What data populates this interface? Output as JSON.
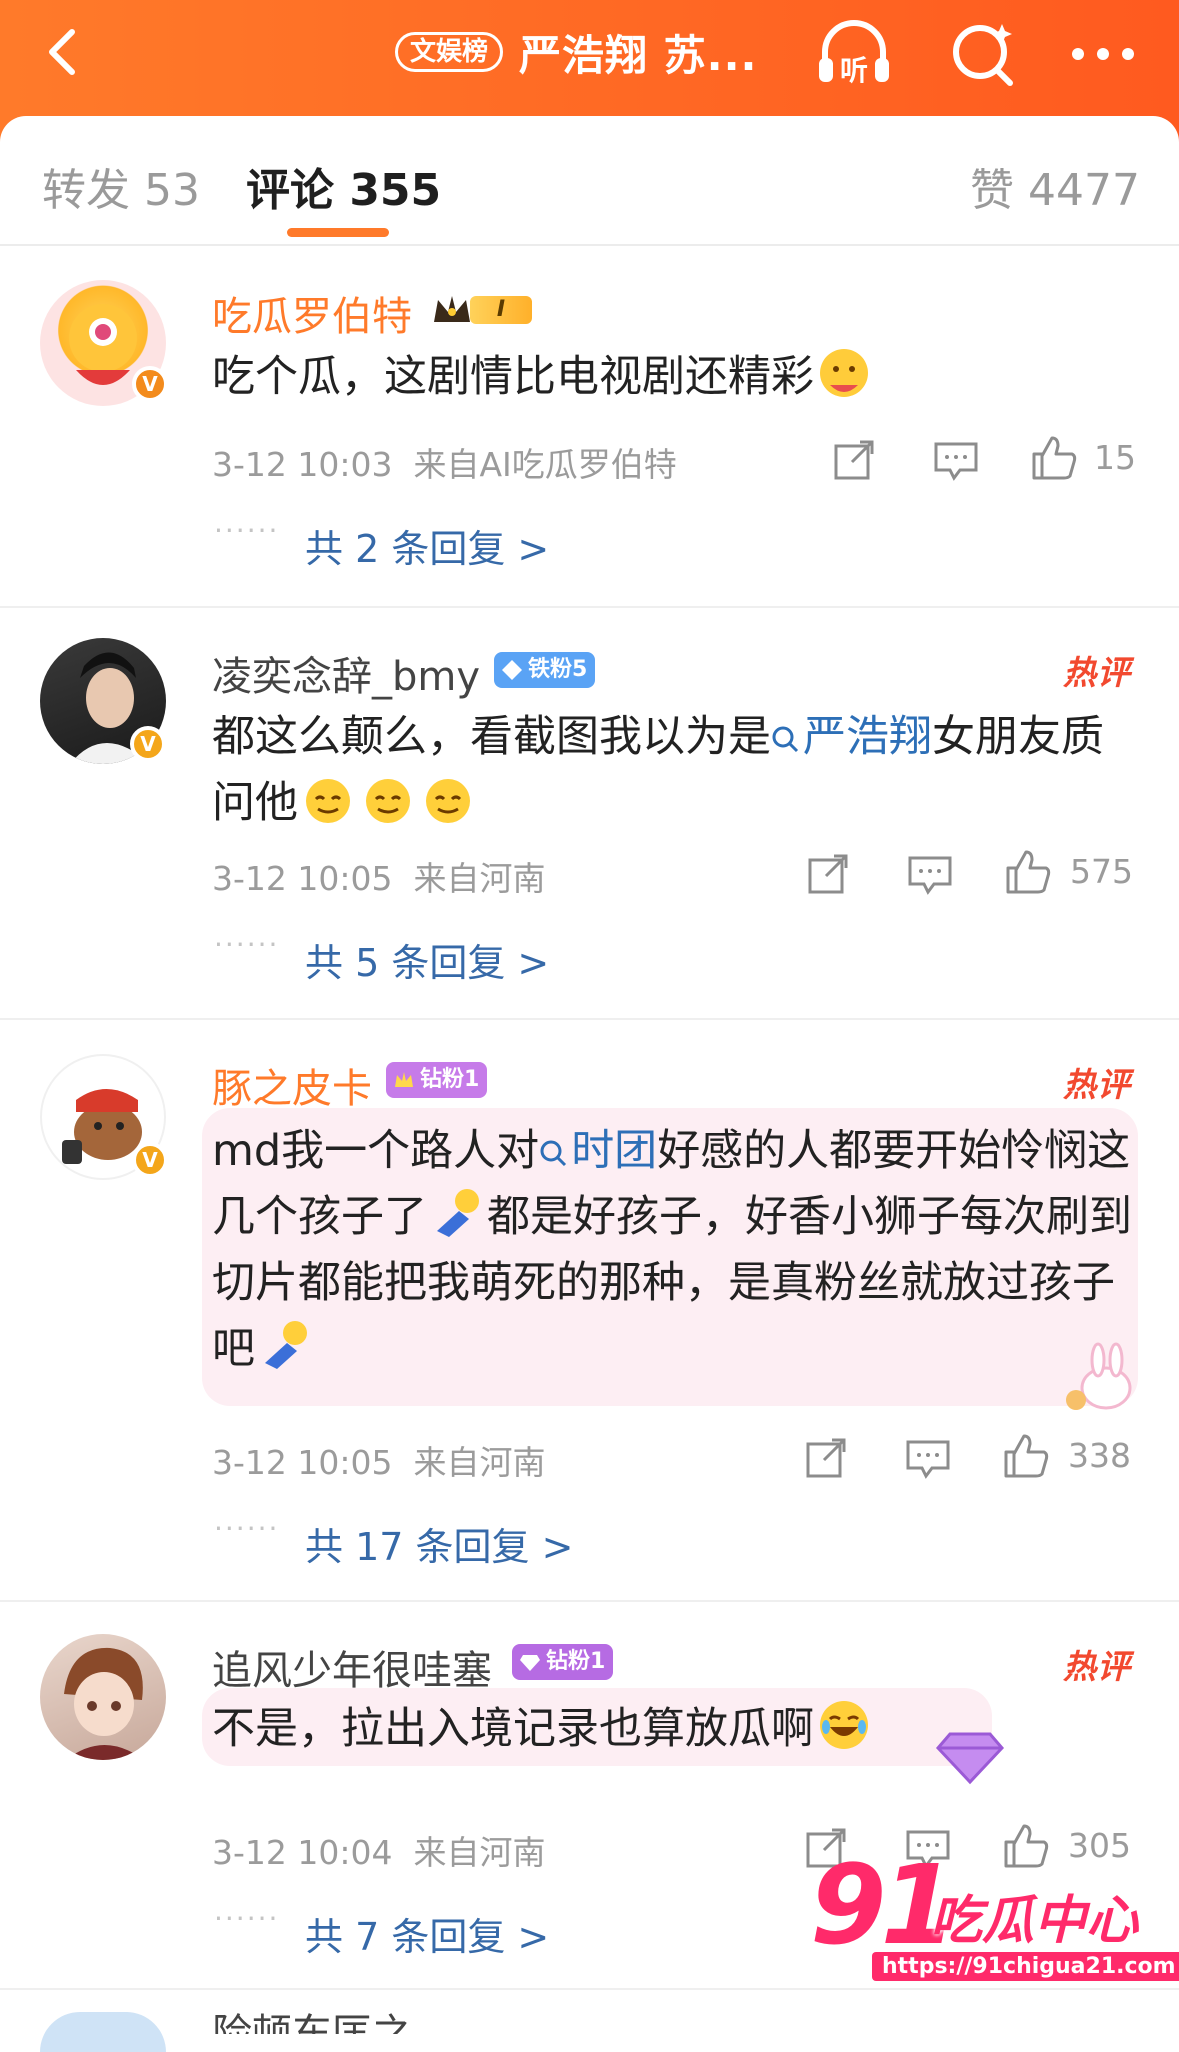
{
  "header": {
    "category_tag": "文娱榜",
    "title": "严浩翔 苏...",
    "back_icon": "chevron-left-icon",
    "listen_label": "听",
    "icons": [
      "headphones-icon",
      "search-icon",
      "more-icon"
    ],
    "accent": "#ff6a22"
  },
  "tabs": {
    "reposts": "转发 53",
    "comments": "评论 355",
    "likes": "赞 4477"
  },
  "comments": [
    {
      "username": "吃瓜罗伯特",
      "badge": "I",
      "text": "吃个瓜，这剧情比电视剧还精彩",
      "time": "3-12 10:03",
      "source": "来自AI吃瓜罗伯特",
      "likes": "15",
      "replies": "共 2 条回复 >"
    },
    {
      "username": "凌奕念辞_bmy",
      "badge": "铁粉5",
      "hot": "热评",
      "text_before": "都这么颠么，看截图我以为是",
      "link": "严浩翔",
      "text_after": "女朋友质问他",
      "time": "3-12 10:05",
      "source": "来自河南",
      "likes": "575",
      "replies": "共 5 条回复 >"
    },
    {
      "username": "豚之皮卡",
      "badge": "钻粉1",
      "hot": "热评",
      "text_before": "md我一个路人对",
      "link": "时团",
      "text_mid": "好感的人都要开始怜悯这几个孩子了",
      "text_after": "都是好孩子，好香小狮子每次刷到切片都能把我萌死的那种，是真粉丝就放过孩子吧",
      "time": "3-12 10:05",
      "source": "来自河南",
      "likes": "338",
      "replies": "共 17 条回复 >"
    },
    {
      "username": "追风少年很哇塞",
      "badge": "钻粉1",
      "hot": "热评",
      "text": "不是，拉出入境记录也算放瓜啊",
      "time": "3-12 10:04",
      "source": "来自河南",
      "likes": "305",
      "replies": "共 7 条回复 >"
    }
  ],
  "next_user_partial": "险顿东匡之",
  "watermark": {
    "brand_number": "91",
    "brand_text": "吃瓜中心",
    "url": "https://91chigua21.com"
  },
  "dots": "······"
}
